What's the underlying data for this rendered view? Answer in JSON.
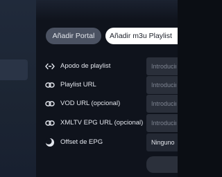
{
  "tabs": [
    {
      "label": "Añadir Portal"
    },
    {
      "label": "Añadir m3u Playlist"
    }
  ],
  "rows": [
    {
      "label": "Apodo de playlist",
      "icon": "code-arrows-icon",
      "placeholder": "Introducir"
    },
    {
      "label": "Playlist URL",
      "icon": "link-icon",
      "placeholder": "Introducir"
    },
    {
      "label": "VOD URL (opcional)",
      "icon": "link-icon",
      "placeholder": "Introducir"
    },
    {
      "label": "XMLTV EPG URL (opcional)",
      "icon": "link-icon",
      "placeholder": "Introducir"
    },
    {
      "label": "Offset de EPG",
      "icon": "moon-clock-icon",
      "value": "Ninguno"
    }
  ],
  "colors": {
    "background": "#0f131c",
    "active_tab": "#ffffff",
    "inactive_tab": "#4b5262",
    "field": "#2a2f3a"
  }
}
